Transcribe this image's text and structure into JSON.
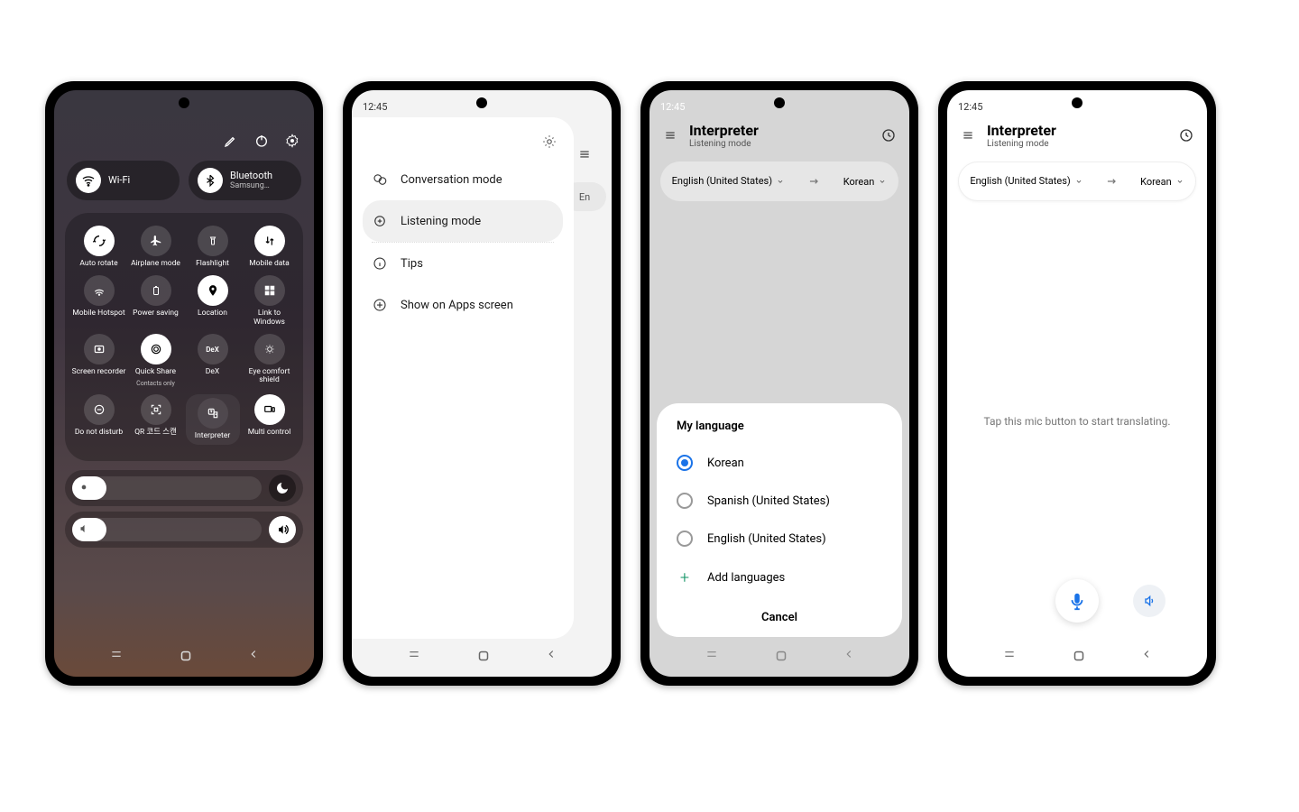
{
  "phone1": {
    "wifi": {
      "label": "Wi-Fi"
    },
    "bluetooth": {
      "label": "Bluetooth",
      "sub": "Samsung…"
    },
    "tiles": [
      [
        {
          "label": "Auto rotate",
          "on": true
        },
        {
          "label": "Airplane mode",
          "on": false
        },
        {
          "label": "Flashlight",
          "on": false
        },
        {
          "label": "Mobile data",
          "on": true
        }
      ],
      [
        {
          "label": "Mobile Hotspot",
          "on": false
        },
        {
          "label": "Power saving",
          "on": false
        },
        {
          "label": "Location",
          "on": true
        },
        {
          "label": "Link to Windows",
          "on": false
        }
      ],
      [
        {
          "label": "Screen recorder",
          "on": false
        },
        {
          "label": "Quick Share",
          "sub": "Contacts only",
          "on": true
        },
        {
          "label": "DeX",
          "on": false
        },
        {
          "label": "Eye comfort shield",
          "on": false
        }
      ],
      [
        {
          "label": "Do not disturb",
          "on": false
        },
        {
          "label": "QR 코드 스캔",
          "on": false
        },
        {
          "label": "Interpreter",
          "on": false,
          "hl": true
        },
        {
          "label": "Multi control",
          "on": true
        }
      ]
    ]
  },
  "phone2": {
    "clock": "12:45",
    "menu": {
      "conversation": "Conversation mode",
      "listening": "Listening mode",
      "tips": "Tips",
      "show": "Show on Apps screen"
    },
    "peek": "En"
  },
  "phone3": {
    "clock": "12:45",
    "title": "Interpreter",
    "subtitle": "Listening mode",
    "lang_from": "English (United States)",
    "lang_to": "Korean",
    "sheet": {
      "title": "My language",
      "opt1": "Korean",
      "opt2": "Spanish (United States)",
      "opt3": "English (United States)",
      "add": "Add languages",
      "cancel": "Cancel"
    }
  },
  "phone4": {
    "clock": "12:45",
    "title": "Interpreter",
    "subtitle": "Listening mode",
    "lang_from": "English (United States)",
    "lang_to": "Korean",
    "hint": "Tap this mic button to start translating."
  }
}
